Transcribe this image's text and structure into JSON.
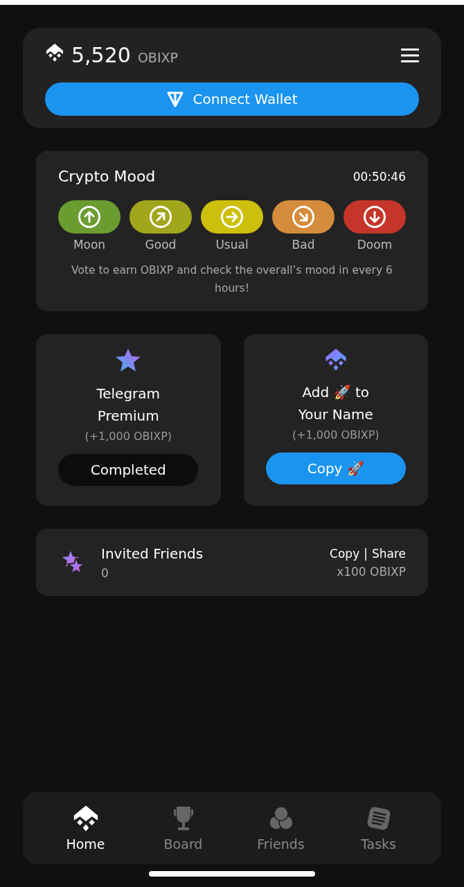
{
  "header": {
    "balance": "5,520",
    "unit": "OBIXP",
    "connect_button": "Connect Wallet"
  },
  "mood": {
    "title": "Crypto Mood",
    "timer": "00:50:46",
    "options": [
      {
        "label": "Moon",
        "kind": "up",
        "color": "#6b9c2f"
      },
      {
        "label": "Good",
        "kind": "up-right",
        "color": "#a2a61b"
      },
      {
        "label": "Usual",
        "kind": "right",
        "color": "#cdc00c"
      },
      {
        "label": "Bad",
        "kind": "down-right",
        "color": "#d58c3c"
      },
      {
        "label": "Doom",
        "kind": "down",
        "color": "#c5352a"
      }
    ],
    "note": "Vote to earn OBIXP and check the overall’s mood in every 6 hours!"
  },
  "tasks": [
    {
      "kind": "star",
      "title": [
        "Telegram",
        "Premium"
      ],
      "reward": "(+1,000 OBIXP)",
      "button": "Completed",
      "completed": true
    },
    {
      "kind": "logo",
      "title": [
        "Add 🚀 to",
        "Your Name"
      ],
      "reward": "(+1,000 OBIXP)",
      "button": "Copy 🚀",
      "completed": false
    }
  ],
  "invite": {
    "title": "Invited Friends",
    "count": "0",
    "copy": "Copy",
    "separator": "|",
    "share": "Share",
    "reward": "x100 OBIXP"
  },
  "nav": [
    {
      "label": "Home",
      "kind": "home",
      "selected": true
    },
    {
      "label": "Board",
      "kind": "trophy",
      "selected": false
    },
    {
      "label": "Friends",
      "kind": "friends",
      "selected": false
    },
    {
      "label": "Tasks",
      "kind": "tasks",
      "selected": false
    }
  ]
}
